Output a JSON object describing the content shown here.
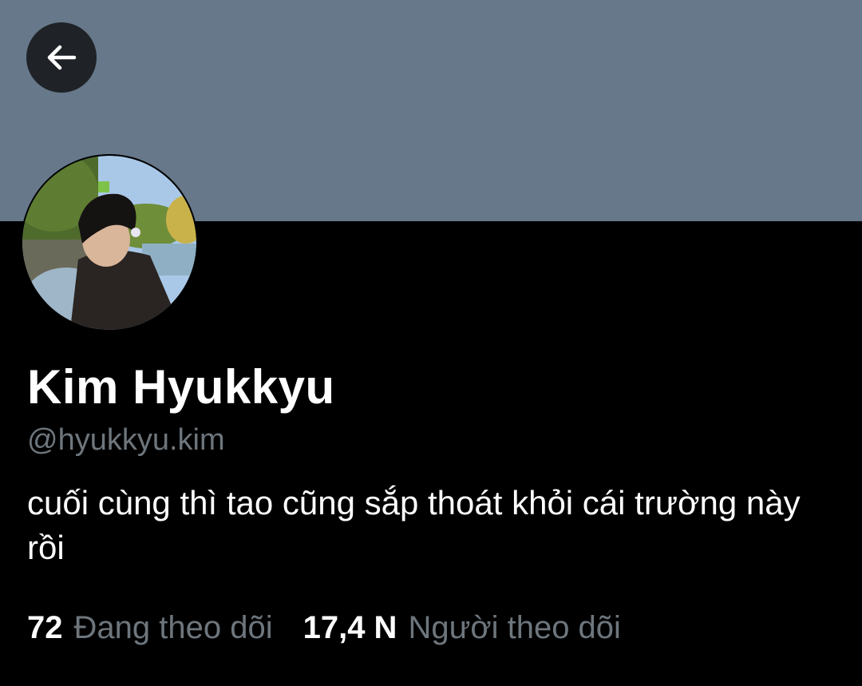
{
  "header": {
    "back_icon": "arrow-left-icon",
    "banner_color": "#66788a"
  },
  "profile": {
    "display_name": "Kim Hyukkyu",
    "handle": "@hyukkyu.kim",
    "bio": "cuối cùng thì tao cũng sắp thoát khỏi cái trường này rồi",
    "avatar_description": "photo-avatar"
  },
  "stats": {
    "following_count": "72",
    "following_label": "Đang theo dõi",
    "followers_count": "17,4 N",
    "followers_label": "Người theo dõi"
  },
  "colors": {
    "background": "#000000",
    "primary_text": "#ffffff",
    "secondary_text": "#6e767d"
  }
}
